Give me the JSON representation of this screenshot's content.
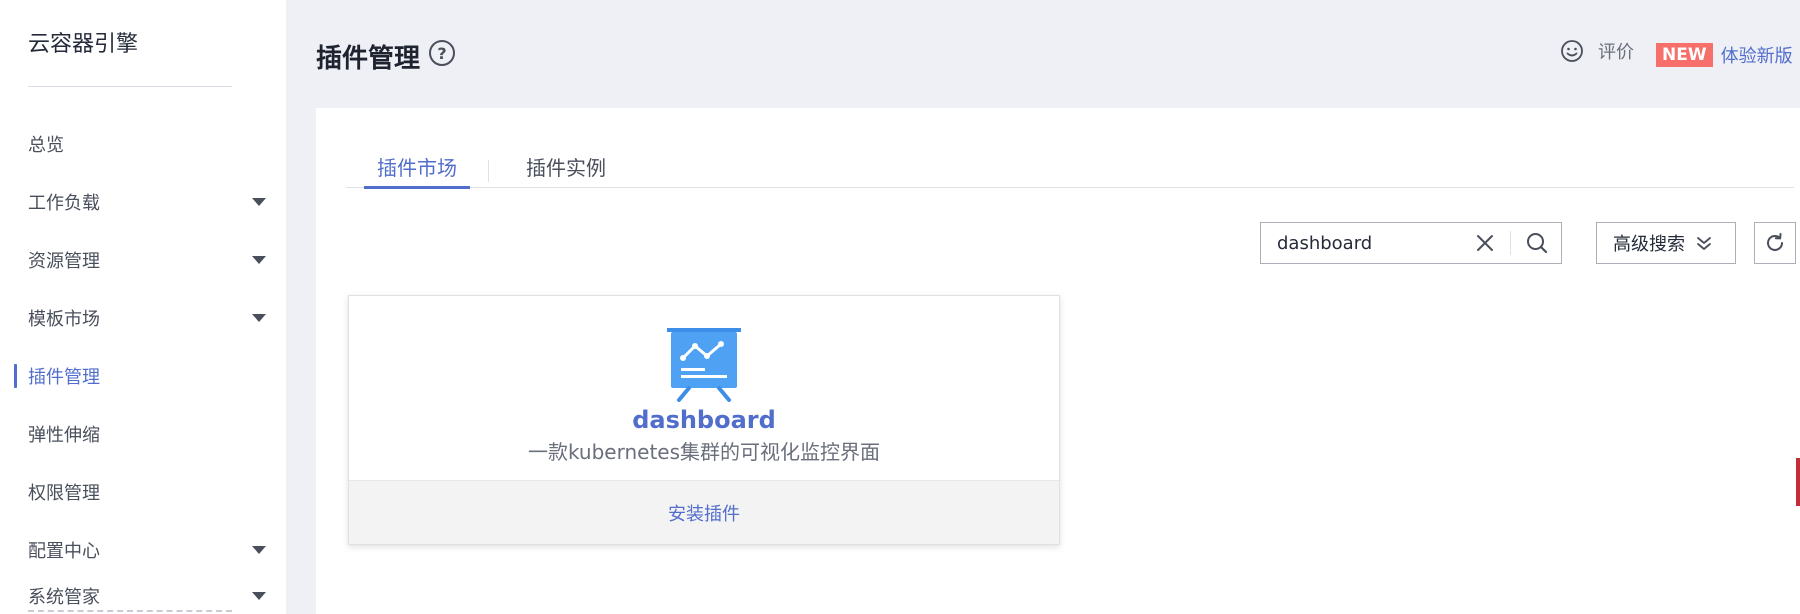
{
  "sidebar": {
    "title": "云容器引擎",
    "items": [
      {
        "label": "总览",
        "has_caret": false,
        "active": false
      },
      {
        "label": "工作负载",
        "has_caret": true,
        "active": false
      },
      {
        "label": "资源管理",
        "has_caret": true,
        "active": false
      },
      {
        "label": "模板市场",
        "has_caret": true,
        "active": false
      },
      {
        "label": "插件管理",
        "has_caret": false,
        "active": true
      },
      {
        "label": "弹性伸缩",
        "has_caret": false,
        "active": false
      },
      {
        "label": "权限管理",
        "has_caret": false,
        "active": false
      },
      {
        "label": "配置中心",
        "has_caret": true,
        "active": false
      },
      {
        "label": "系统管家",
        "has_caret": true,
        "active": false
      }
    ]
  },
  "header": {
    "title": "插件管理",
    "help_icon": "?",
    "rate_label": "评价",
    "new_badge": "NEW",
    "new_version_label": "体验新版"
  },
  "tabs": [
    {
      "label": "插件市场",
      "active": true
    },
    {
      "label": "插件实例",
      "active": false
    }
  ],
  "toolbar": {
    "search_value": "dashboard",
    "advanced_search_label": "高级搜索"
  },
  "plugin_card": {
    "name": "dashboard",
    "description": "一款kubernetes集群的可视化监控界面",
    "install_label": "安装插件",
    "icon": "dashboard-chart-icon"
  },
  "colors": {
    "accent": "#526ecc",
    "badge": "#f66f6a",
    "background": "#eef0f5"
  }
}
